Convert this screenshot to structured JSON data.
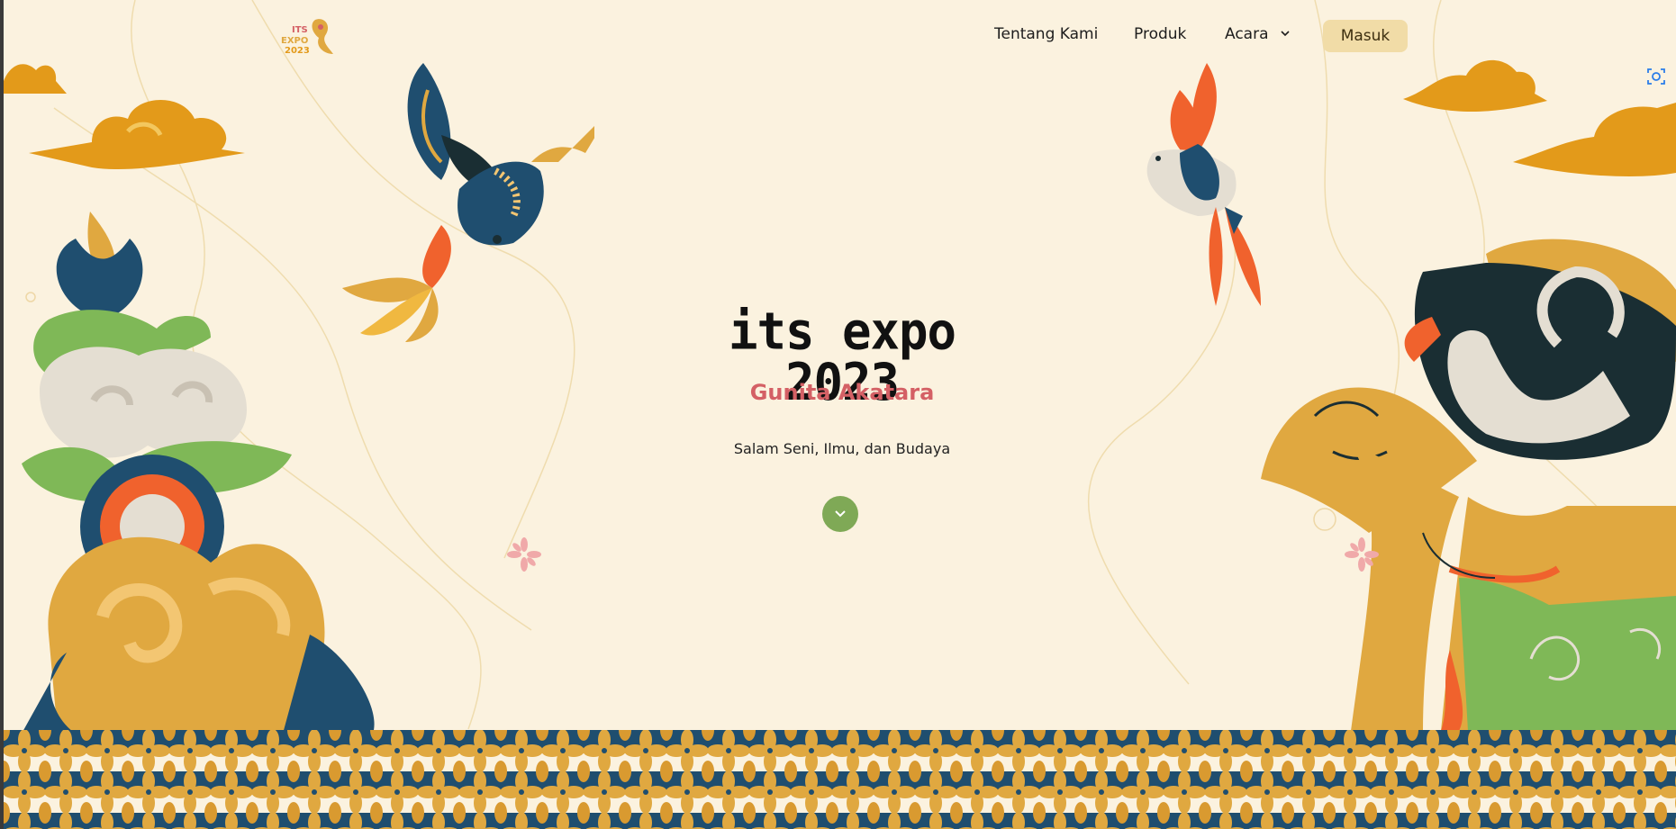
{
  "nav": {
    "logo_text": "ITS EXPO 2023",
    "links": [
      {
        "label": "Tentang Kami"
      },
      {
        "label": "Produk"
      },
      {
        "label": "Acara"
      }
    ],
    "login_label": "Masuk"
  },
  "hero": {
    "title": "its expo 2023",
    "subtitle": "Gunita Akatara",
    "tagline": "Salam Seni, Ilmu, dan Budaya"
  },
  "icons": {
    "dropdown": "chevron-down-icon",
    "scroll": "chevron-down-icon",
    "screenshot": "screenshot-tool-icon"
  },
  "colors": {
    "background": "#fbf2df",
    "accent_red": "#d46065",
    "button_bg": "#f1dca7",
    "scroll_button": "#7fa956",
    "navy": "#1f4e6f",
    "gold": "#e0a840",
    "orange": "#f0622d"
  }
}
